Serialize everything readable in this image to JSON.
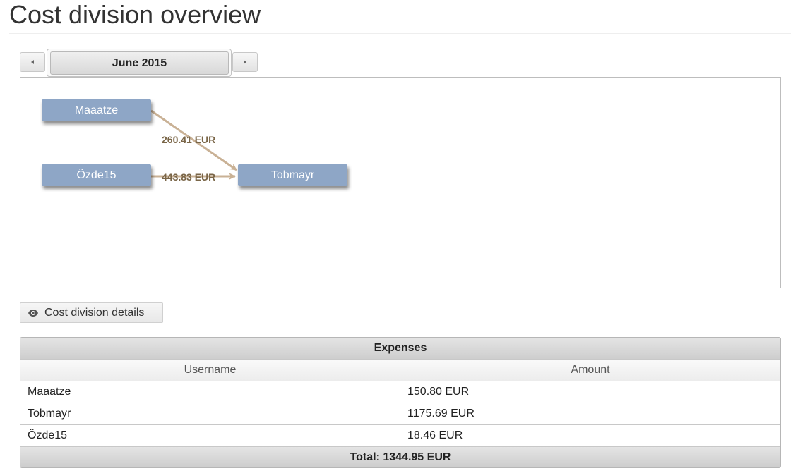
{
  "page": {
    "title": "Cost division overview"
  },
  "month_nav": {
    "current": "June 2015",
    "prev_icon": "triangle-left-icon",
    "next_icon": "triangle-right-icon"
  },
  "graph": {
    "nodes": [
      {
        "id": "maaatze",
        "label": "Maaatze"
      },
      {
        "id": "ozde15",
        "label": "Özde15"
      },
      {
        "id": "tobmayr",
        "label": "Tobmayr"
      }
    ],
    "edges": [
      {
        "from": "Maaatze",
        "to": "Tobmayr",
        "label": "260.41 EUR"
      },
      {
        "from": "Özde15",
        "to": "Tobmayr",
        "label": "443.83 EUR"
      }
    ],
    "node_color": "#8ea6c6",
    "edge_color": "#c9b195"
  },
  "details_button": {
    "label": "Cost division details",
    "icon": "eye-icon"
  },
  "expenses": {
    "caption": "Expenses",
    "columns": [
      "Username",
      "Amount"
    ],
    "rows": [
      {
        "username": "Maaatze",
        "amount": "150.80 EUR"
      },
      {
        "username": "Tobmayr",
        "amount": "1175.69 EUR"
      },
      {
        "username": "Özde15",
        "amount": "18.46 EUR"
      }
    ],
    "total": "Total: 1344.95 EUR"
  }
}
